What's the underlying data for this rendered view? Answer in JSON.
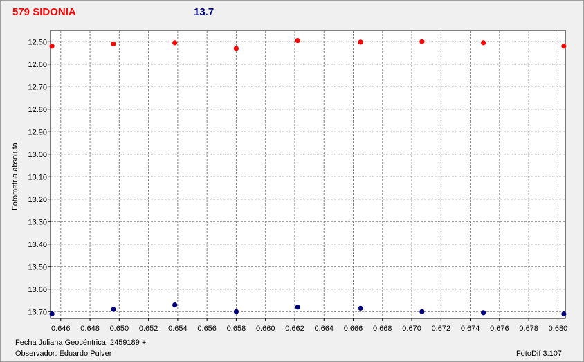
{
  "header": {
    "object_name": "579 SIDONIA",
    "magnitude": "13.7"
  },
  "footer": {
    "julian_date": "Fecha Juliana Geocéntrica: 2459189 +",
    "observer": "Observador: Eduardo Pulver",
    "software": "FotoDif 3.107"
  },
  "colors": {
    "series_target": "#ff0000",
    "series_comparison": "#00007f",
    "grid": "#808080"
  },
  "chart_data": {
    "type": "scatter",
    "title": "",
    "xlabel": "",
    "ylabel": "Fotometría absoluta",
    "xlim": [
      0.6453,
      0.6805
    ],
    "ylim": [
      12.45,
      13.73
    ],
    "y_inverted": true,
    "grid": true,
    "x_ticks": [
      "0.646",
      "0.648",
      "0.650",
      "0.652",
      "0.654",
      "0.656",
      "0.658",
      "0.660",
      "0.662",
      "0.664",
      "0.666",
      "0.668",
      "0.670",
      "0.672",
      "0.674",
      "0.676",
      "0.678",
      "0.680"
    ],
    "y_ticks": [
      "12.50",
      "12.60",
      "12.70",
      "12.80",
      "12.90",
      "13.00",
      "13.10",
      "13.20",
      "13.30",
      "13.40",
      "13.50",
      "13.60",
      "13.70"
    ],
    "series": [
      {
        "color": "#ff0000",
        "x": [
          0.6454,
          0.6496,
          0.6538,
          0.658,
          0.6622,
          0.6665,
          0.6707,
          0.6749,
          0.6804
        ],
        "y": [
          12.52,
          12.51,
          12.505,
          12.53,
          12.495,
          12.502,
          12.5,
          12.505,
          12.52
        ]
      },
      {
        "color": "#00007f",
        "x": [
          0.6454,
          0.6496,
          0.6538,
          0.658,
          0.6622,
          0.6665,
          0.6707,
          0.6749,
          0.6804
        ],
        "y": [
          13.71,
          13.69,
          13.67,
          13.7,
          13.68,
          13.685,
          13.7,
          13.705,
          13.71
        ]
      }
    ]
  }
}
